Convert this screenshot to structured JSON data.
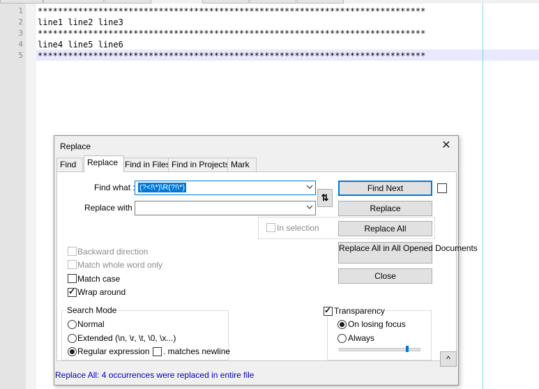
{
  "editor": {
    "line_numbers": [
      "1",
      "2",
      "3",
      "4",
      "5"
    ],
    "lines": [
      "*****************************************************************************",
      "line1 line2 line3",
      "*****************************************************************************",
      "line4 line5 line6",
      "*****************************************************************************"
    ]
  },
  "dialog": {
    "title": "Replace",
    "close_glyph": "✕",
    "tabs": [
      "Find",
      "Replace",
      "Find in Files",
      "Find in Projects",
      "Mark"
    ],
    "find_label": "Find what :",
    "find_value": "(?<!\\*)\\R(?!\\*)",
    "replace_label": "Replace with :",
    "replace_value": "",
    "swap_glyph": "⇅",
    "buttons": {
      "find_next": "Find Next",
      "replace": "Replace",
      "replace_all": "Replace All",
      "replace_all_opened": "Replace All in All Opened Documents",
      "close": "Close",
      "up": "^"
    },
    "in_selection": "In selection",
    "options": {
      "backward": "Backward direction",
      "whole_word": "Match whole word only",
      "match_case": "Match case",
      "wrap_around": "Wrap around"
    },
    "search_mode": {
      "title": "Search Mode",
      "normal": "Normal",
      "extended": "Extended (\\n, \\r, \\t, \\0, \\x...)",
      "regex": "Regular expression",
      "matches_newline": ". matches newline"
    },
    "transparency": {
      "title": "Transparency",
      "on_losing_focus": "On losing focus",
      "always": "Always",
      "level": 0.85
    },
    "status": "Replace All: 4 occurrences were replaced in entire file"
  }
}
